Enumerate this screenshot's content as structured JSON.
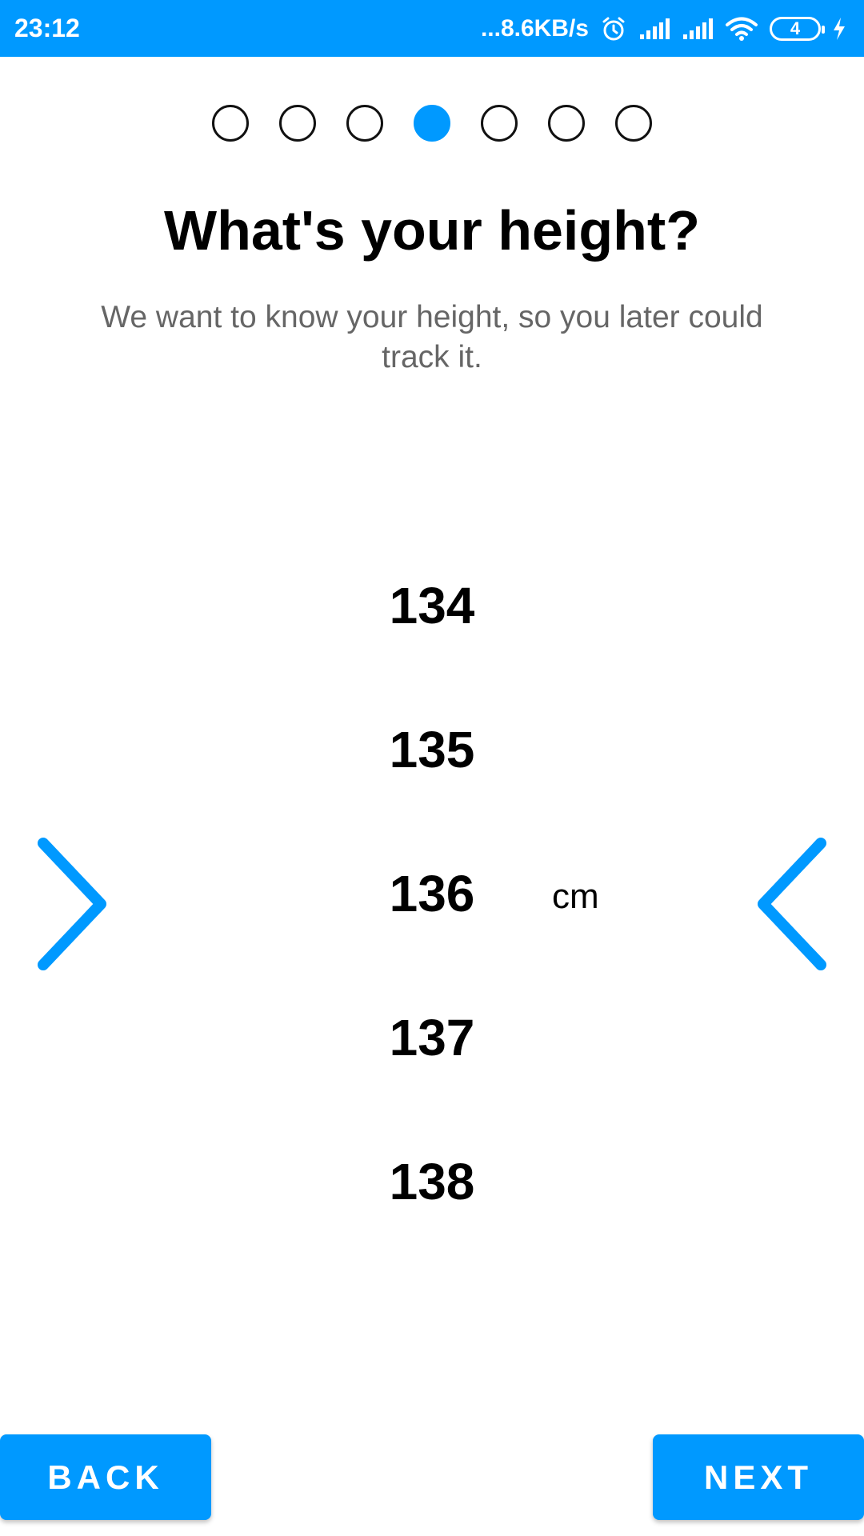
{
  "status_bar": {
    "time": "23:12",
    "network_speed": "...8.6KB/s",
    "battery_level": "4",
    "icons": [
      "alarm-icon",
      "signal-icon",
      "signal-icon",
      "wifi-icon",
      "battery-icon",
      "charging-icon"
    ]
  },
  "progress": {
    "total_steps": 7,
    "current_step": 4
  },
  "header": {
    "title": "What's your height?",
    "subtitle": "We want to know your height, so you later could track it."
  },
  "picker": {
    "values": [
      "134",
      "135",
      "136",
      "137",
      "138"
    ],
    "selected": "136",
    "unit": "cm"
  },
  "footer": {
    "back_label": "BACK",
    "next_label": "NEXT"
  },
  "colors": {
    "accent": "#0099ff",
    "title": "#000000",
    "subtitle": "#666666"
  }
}
